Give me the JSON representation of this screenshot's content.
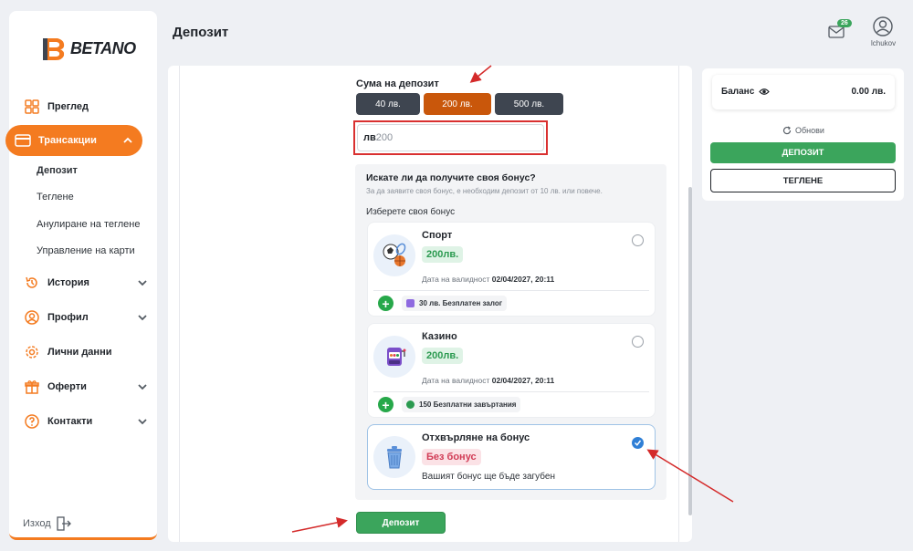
{
  "brand": {
    "name": "BETANO",
    "accent": "#f47b20"
  },
  "sidebar": {
    "items": [
      {
        "label": "Преглед",
        "icon": "grid-icon"
      },
      {
        "label": "Трансакции",
        "icon": "card-icon"
      },
      {
        "label": "История",
        "icon": "history-icon"
      },
      {
        "label": "Профил",
        "icon": "profile-icon"
      },
      {
        "label": "Лични данни",
        "icon": "gear-icon"
      },
      {
        "label": "Оферти",
        "icon": "gift-icon"
      },
      {
        "label": "Контакти",
        "icon": "help-icon"
      }
    ],
    "subitems": [
      "Депозит",
      "Теглене",
      "Анулиране на теглене",
      "Управление на карти"
    ],
    "logout": "Изход"
  },
  "header": {
    "title": "Депозит",
    "mail_badge": "26",
    "username": "lchukov"
  },
  "deposit": {
    "amount_label": "Сума на депозит",
    "amount_buttons": [
      "40 лв.",
      "200 лв.",
      "500 лв."
    ],
    "selected_amount": "200 лв.",
    "input_currency": "лв",
    "input_value": "200",
    "bonus_question": "Искате ли да получите своя бонус?",
    "bonus_hint": "За да заявите своя бонус, е необходим депозит от 10 лв. или повече.",
    "choose_label": "Изберете своя бонус",
    "cards": [
      {
        "title": "Спорт",
        "amount": "200лв.",
        "valid_label": "Дата на валидност",
        "valid_date": "02/04/2027, 20:11",
        "perk": "30 лв. Безплатен залог",
        "icon": "sport-balls-icon",
        "selected": false
      },
      {
        "title": "Казино",
        "amount": "200лв.",
        "valid_label": "Дата на валидност",
        "valid_date": "02/04/2027, 20:11",
        "perk": "150 Безплатни завъртания",
        "icon": "slot-machine-icon",
        "selected": false
      },
      {
        "title": "Отхвърляне на бонус",
        "amount": "Без бонус",
        "note": "Вашият бонус ще бъде загубен",
        "icon": "trash-icon",
        "selected": true
      }
    ],
    "submit": "Депозит"
  },
  "balance": {
    "label": "Баланс",
    "value": "0.00 лв.",
    "refresh": "Обнови",
    "deposit": "ДЕПОЗИТ",
    "withdraw": "ТЕГЛЕНЕ"
  }
}
